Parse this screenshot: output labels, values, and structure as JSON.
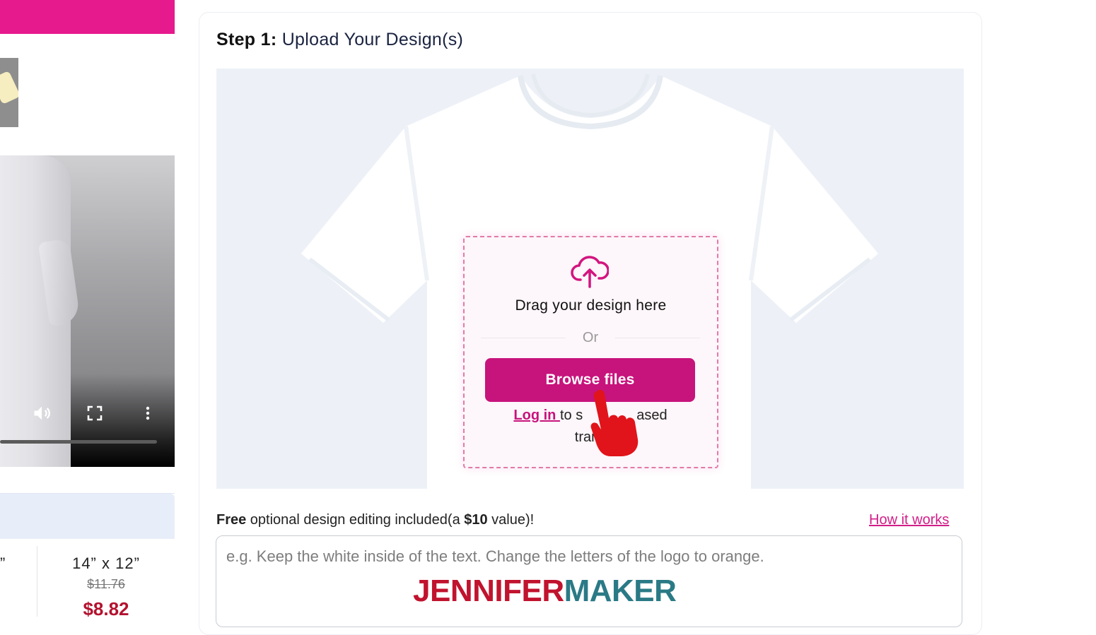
{
  "step": {
    "label": "Step 1:",
    "title": "Upload Your Design(s)"
  },
  "dropzone": {
    "drag_text": "Drag your design here",
    "or_text": "Or",
    "browse_label": "Browse files",
    "login_link": "Log in ",
    "login_rest": "to s",
    "login_rest_tail": "ased",
    "login_line2": "trans"
  },
  "editing": {
    "free": "Free",
    "middle": " optional design editing included(a ",
    "price": "$10",
    "end": " value)!",
    "how_link": "How it works",
    "placeholder": "e.g. Keep the white inside of the text. Change the letters of the logo to orange."
  },
  "size": {
    "prev_mark": "”",
    "name": "14” x 12”",
    "old_price": "$11.76",
    "new_price": "$8.82"
  },
  "watermark": {
    "part1": "JENNIFER",
    "part2": "MAKER"
  },
  "colors": {
    "accent": "#c7137c",
    "banner": "#e6198d",
    "price": "#b3122e"
  },
  "icons": [
    "cloud-upload-icon",
    "volume-icon",
    "fullscreen-icon",
    "more-vertical-icon",
    "hand-cursor-icon"
  ]
}
